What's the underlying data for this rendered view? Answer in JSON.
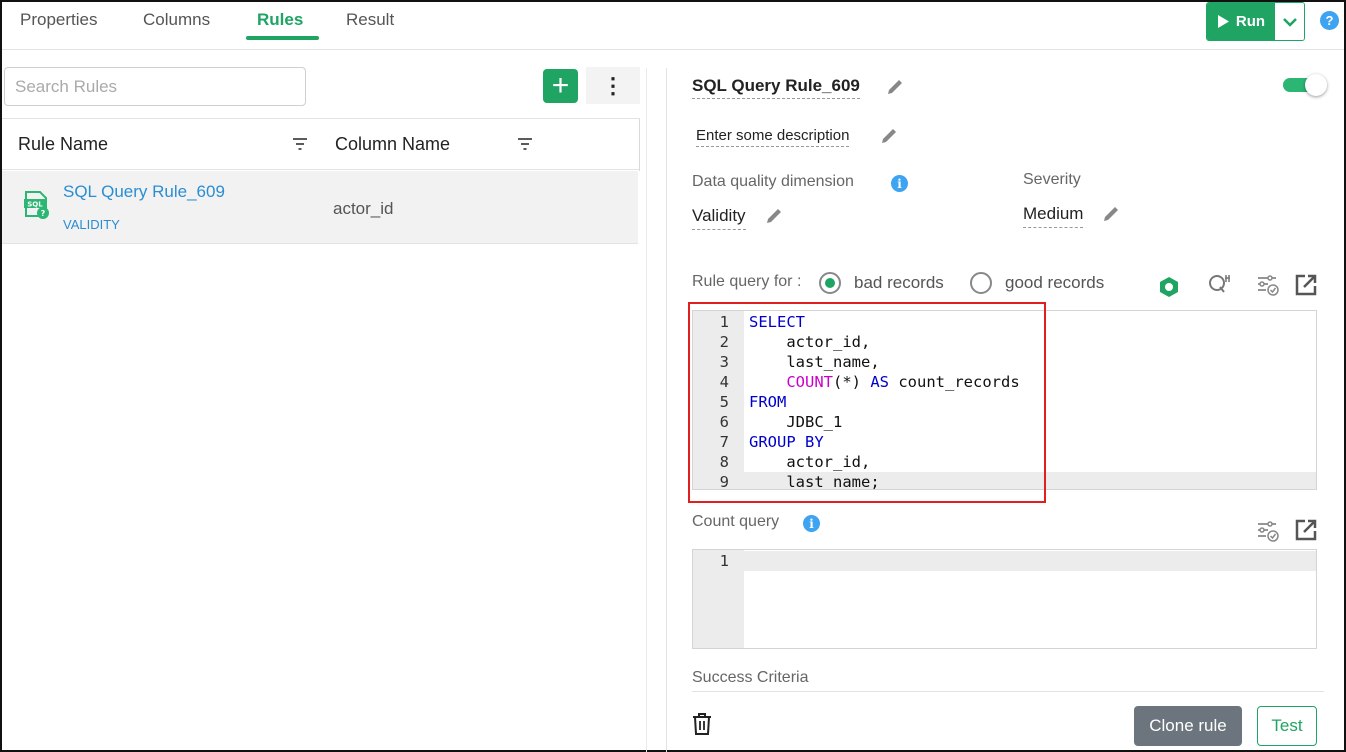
{
  "tabs": [
    {
      "label": "Properties"
    },
    {
      "label": "Columns"
    },
    {
      "label": "Rules"
    },
    {
      "label": "Result"
    }
  ],
  "toolbar": {
    "run_label": "Run",
    "help_label": "?"
  },
  "left": {
    "search_placeholder": "Search Rules",
    "add_label": "+",
    "more_label": "⋮",
    "columns": [
      "Rule Name",
      "Column Name"
    ],
    "rows": [
      {
        "rule_name": "SQL Query Rule_609",
        "dimension": "VALIDITY",
        "column_name": "actor_id"
      }
    ]
  },
  "detail": {
    "title": "SQL Query Rule_609",
    "enabled": true,
    "description": "Enter some description",
    "dimension_label": "Data quality dimension",
    "dimension_value": "Validity",
    "severity_label": "Severity",
    "severity_value": "Medium",
    "rule_query_label": "Rule query for :",
    "radio_bad": "bad records",
    "radio_good": "good records",
    "selected_radio": "bad records",
    "rule_query_lines": [
      {
        "n": "1"
      },
      {
        "n": "2",
        "text": "    actor_id,"
      },
      {
        "n": "3",
        "text": "    last_name,"
      },
      {
        "n": "4"
      },
      {
        "n": "5"
      },
      {
        "n": "6",
        "text": "    JDBC_1"
      },
      {
        "n": "7"
      },
      {
        "n": "8",
        "text": "    actor_id,"
      },
      {
        "n": "9",
        "text": "    last_name;"
      }
    ],
    "code_tokens": {
      "select": "SELECT",
      "count_indent": "    ",
      "count_fn": "COUNT",
      "count_args": "(*) ",
      "as": "AS",
      "count_alias": " count_records",
      "from": "FROM",
      "group_by": "GROUP BY"
    },
    "count_query_label": "Count query",
    "count_query_lines": [
      {
        "n": "1"
      }
    ],
    "success_criteria_label": "Success Criteria",
    "clone_label": "Clone rule",
    "test_label": "Test"
  },
  "colors": {
    "accent": "#1fa463",
    "link": "#2a8dd4",
    "highlight": "#e02020"
  }
}
